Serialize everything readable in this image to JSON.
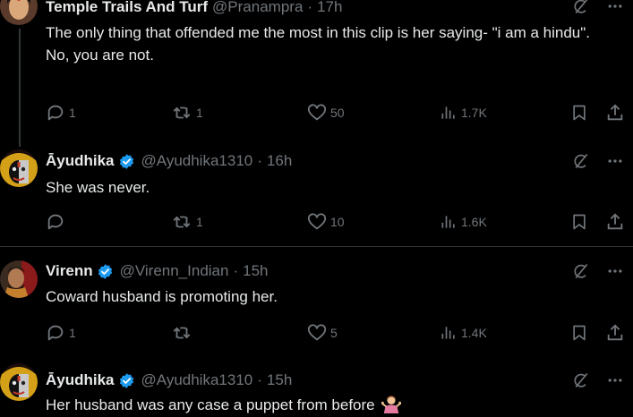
{
  "tweets": [
    {
      "display_name": "Temple Trails And Turf",
      "handle": "@Pranampra",
      "dot": "·",
      "time": "17h",
      "verified": false,
      "lines": [
        "The only thing that offended me the most in this clip is her saying- \"i am a hindu\".",
        "No, you are not."
      ],
      "reply_count": "1",
      "repost_count": "1",
      "like_count": "50",
      "view_count": "1.7K"
    },
    {
      "display_name": "Āyudhika",
      "handle": "@Ayudhika1310",
      "dot": "·",
      "time": "16h",
      "verified": true,
      "lines": [
        "She was never."
      ],
      "reply_count": "",
      "repost_count": "1",
      "like_count": "10",
      "view_count": "1.6K"
    },
    {
      "display_name": "Virenn",
      "handle": "@Virenn_Indian",
      "dot": "·",
      "time": "15h",
      "verified": true,
      "lines": [
        "Coward husband is promoting her."
      ],
      "reply_count": "1",
      "repost_count": "",
      "like_count": "5",
      "view_count": "1.4K"
    },
    {
      "display_name": "Āyudhika",
      "handle": "@Ayudhika1310",
      "dot": "·",
      "time": "15h",
      "verified": true,
      "lines": [
        "Her husband was any case a puppet from before"
      ],
      "trailing_emoji": "person-shrugging-emoji"
    }
  ],
  "colors": {
    "background": "#000000",
    "text_primary": "#e7e9ea",
    "text_secondary": "#71767b",
    "divider": "#2f3336",
    "verified_blue": "#1d9bf0"
  },
  "icons": [
    "grok-icon",
    "more-icon",
    "reply-icon",
    "repost-icon",
    "like-icon",
    "views-icon",
    "bookmark-icon",
    "share-icon",
    "verified-badge-icon"
  ]
}
